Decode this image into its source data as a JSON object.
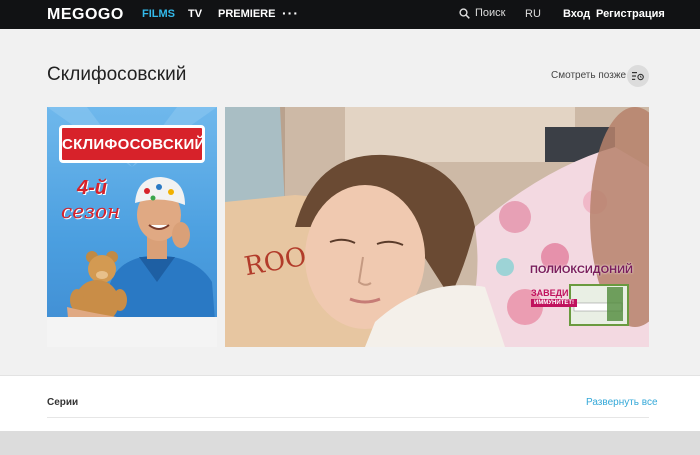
{
  "topbar": {
    "logo": "MEGOGO",
    "nav": [
      "FILMS",
      "TV",
      "PREMIERE"
    ],
    "more": "···",
    "search_label": "Поиск",
    "language": "RU",
    "login": "Вход",
    "register": "Регистрация",
    "accent": "#33b9ea"
  },
  "page": {
    "title": "Склифосовский",
    "watch_later": "Смотреть позже"
  },
  "poster": {
    "title_sign": "СКЛИФОСОВСКИЙ",
    "season_number": "4-й",
    "season_word": "сезон"
  },
  "video": {
    "promo_title": "ПОЛИОКСИДОНИЙ",
    "promo_subtitle": "ЗАВЕДИ",
    "promo_tag": "ИММУНИТЕТ!"
  },
  "episodes": {
    "label": "Серии",
    "expand_all": "Развернуть все"
  }
}
